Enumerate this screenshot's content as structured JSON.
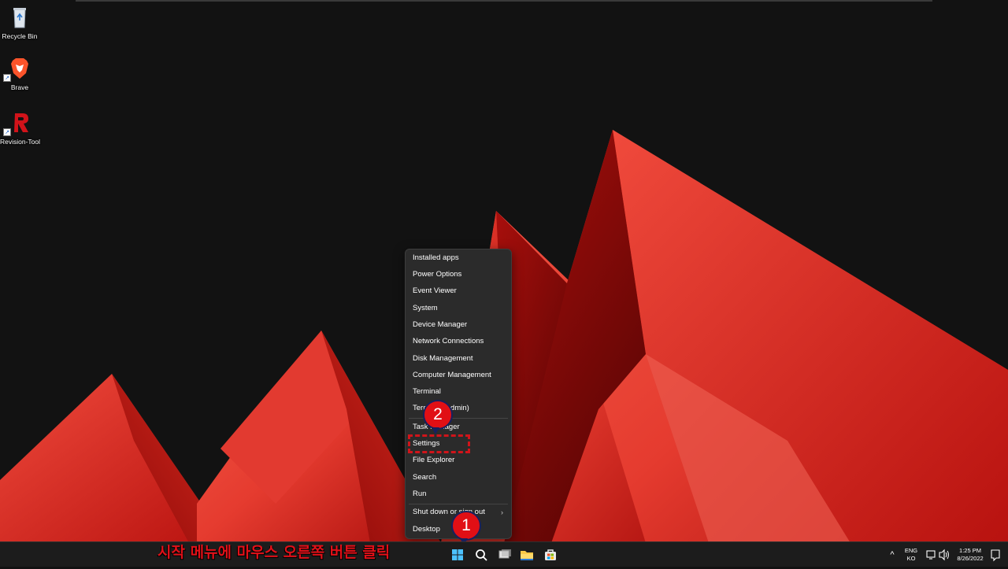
{
  "desktop": {
    "icons": [
      {
        "label": "Recycle Bin",
        "icon": "recycle-bin-icon"
      },
      {
        "label": "Brave",
        "icon": "brave-icon"
      },
      {
        "label": "Revision-Tool",
        "icon": "revision-tool-icon"
      }
    ]
  },
  "context_menu": {
    "group1": [
      "Installed apps",
      "Power Options",
      "Event Viewer",
      "System",
      "Device Manager",
      "Network Connections",
      "Disk Management",
      "Computer Management",
      "Terminal",
      "Terminal (Admin)"
    ],
    "group2": [
      "Task Manager",
      "Settings",
      "File Explorer",
      "Search",
      "Run"
    ],
    "group3": [
      "Shut down or sign out",
      "Desktop"
    ],
    "submenu_glyph": "›"
  },
  "annotations": {
    "step1": "1",
    "step2": "2",
    "caption": "시작 메뉴에 마우스 오른쪽 버튼 클릭",
    "color": "#e10f15"
  },
  "taskbar": {
    "icons": [
      "windows-start-icon",
      "search-icon",
      "task-view-icon",
      "file-explorer-icon",
      "microsoft-store-icon"
    ],
    "tray": {
      "chevron": "^",
      "lang_top": "ENG",
      "lang_bottom": "KO",
      "time": "1:25 PM",
      "date": "8/26/2022"
    }
  },
  "colors": {
    "accent_red": "#e10f15",
    "menu_bg": "#2b2b2b",
    "taskbar_bg": "#1c1c1c"
  }
}
